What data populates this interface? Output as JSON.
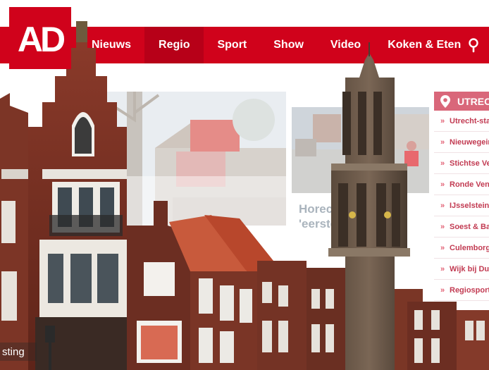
{
  "site": {
    "logo_text": "AD"
  },
  "nav": {
    "items": [
      {
        "label": "Nieuws"
      },
      {
        "label": "Regio"
      },
      {
        "label": "Sport"
      },
      {
        "label": "Show"
      },
      {
        "label": "Video"
      },
      {
        "label": "Koken & Eten"
      }
    ],
    "search_icon": "search-icon"
  },
  "main": {
    "headline": "Horeca maakt 'eerste dag v"
  },
  "sidebar": {
    "header": "UTRECHT",
    "items": [
      {
        "label": "Utrecht-stad"
      },
      {
        "label": "Nieuwegein"
      },
      {
        "label": "Stichtse Vecht"
      },
      {
        "label": "Ronde Venen"
      },
      {
        "label": "IJsselstein"
      },
      {
        "label": "Soest & Baarn"
      },
      {
        "label": "Culemborg"
      },
      {
        "label": "Wijk bij Duurstede"
      },
      {
        "label": "Regiosport"
      }
    ]
  },
  "overlay": {
    "ticker_text": "sting"
  },
  "colors": {
    "brand_red": "#d0021b",
    "nav_active": "#b70018",
    "sidebar_header": "#d9677a",
    "sidebar_text": "#c23b52",
    "headline_text": "#aab4bd"
  }
}
